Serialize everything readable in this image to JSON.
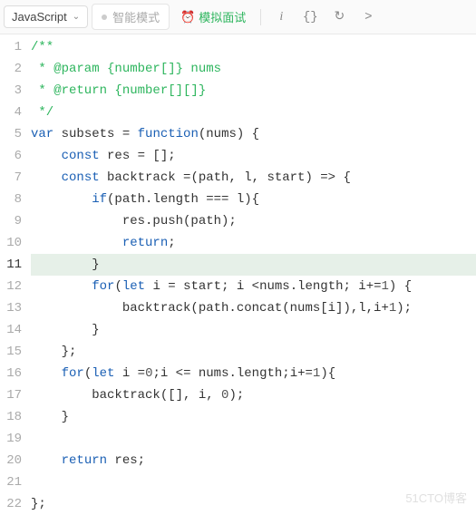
{
  "toolbar": {
    "language": "JavaScript",
    "smart_mode": "智能模式",
    "mock_interview": "模拟面试",
    "info_icon": "i",
    "braces_icon": "{}",
    "refresh_icon": "↻",
    "expand_icon": ">"
  },
  "code": {
    "lines": [
      "/**",
      " * @param {number[]} nums",
      " * @return {number[][]}",
      " */",
      "var subsets = function(nums) {",
      "    const res = [];",
      "    const backtrack =(path, l, start) => {",
      "        if(path.length === l){",
      "            res.push(path);",
      "            return;",
      "        }",
      "        for(let i = start; i <nums.length; i+=1) {",
      "            backtrack(path.concat(nums[i]),l,i+1);",
      "        }",
      "    };",
      "    for(let i =0;i <= nums.length;i+=1){",
      "        backtrack([], i, 0);",
      "    }",
      "",
      "    return res;",
      "",
      "};"
    ],
    "line_count": 22,
    "highlighted_line": 11
  },
  "watermark": "51CTO博客"
}
